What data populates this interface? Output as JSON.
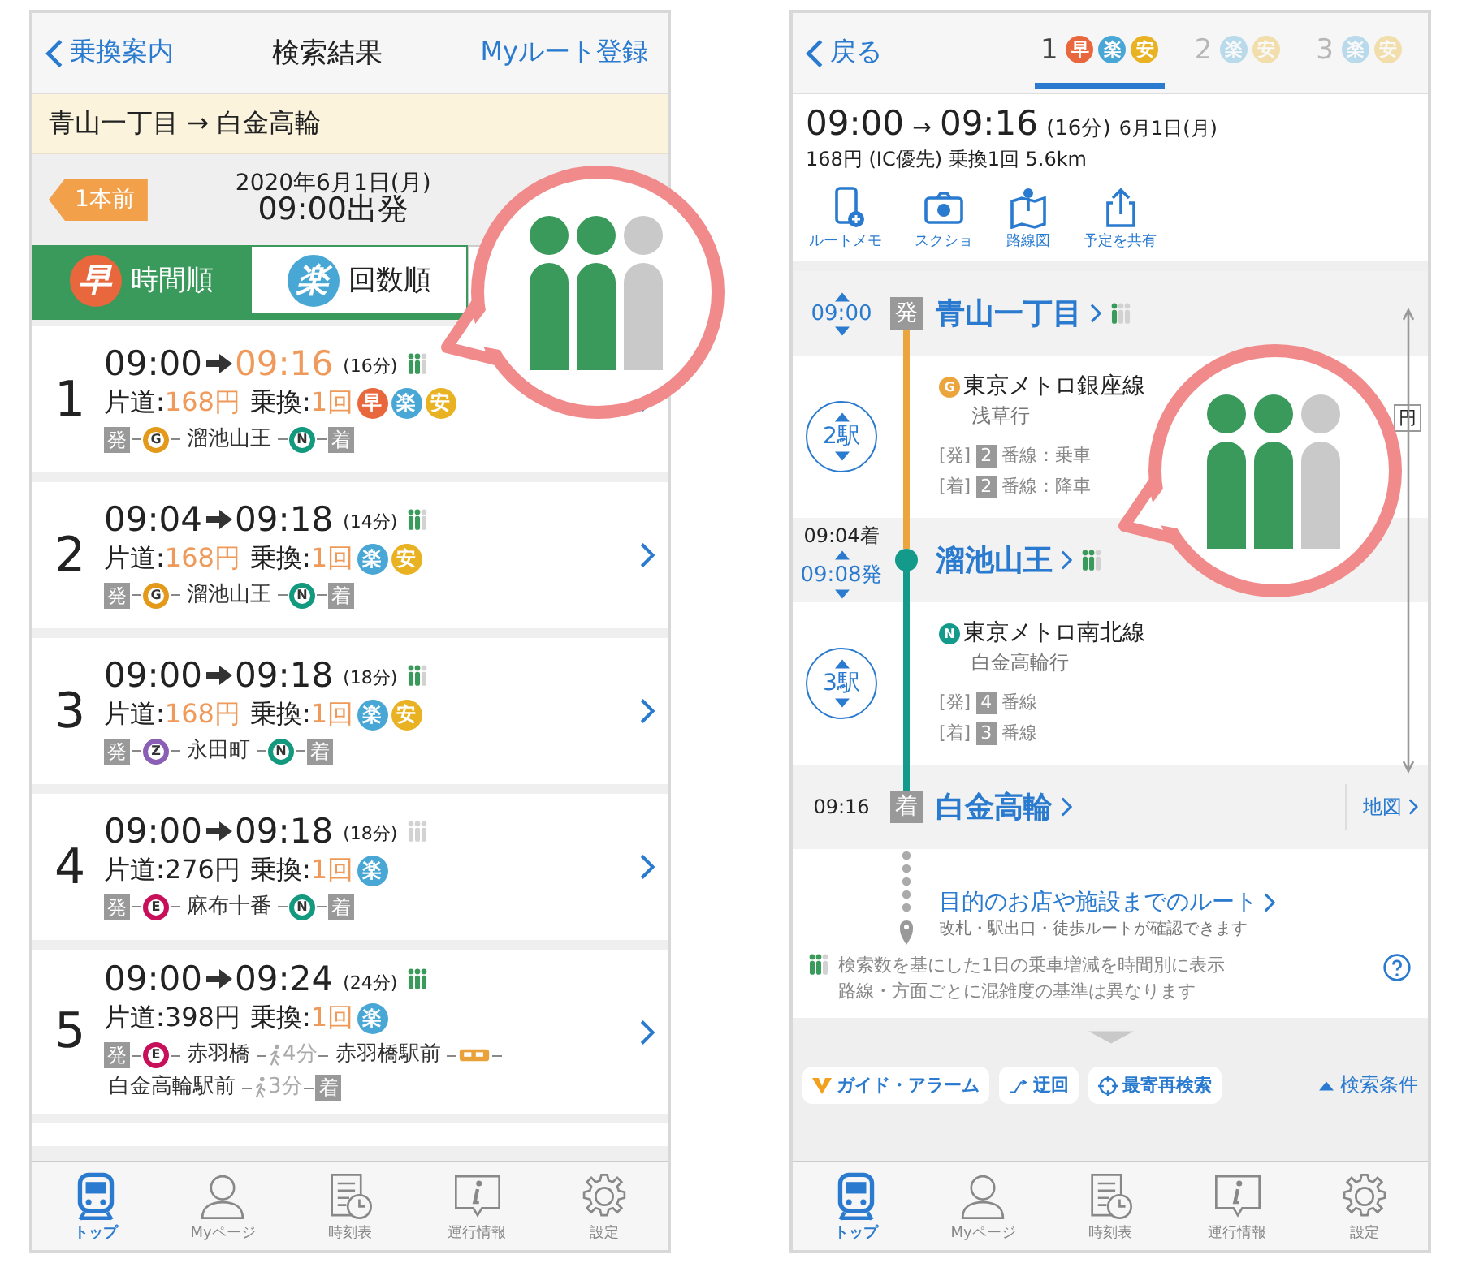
{
  "left": {
    "header": {
      "back": "乗換案内",
      "title": "検索結果",
      "action": "Myルート登録"
    },
    "route_bar": "青山一丁目 → 白金高輪",
    "prev_button": "1本前",
    "date": "2020年6月1日(月)",
    "departure": "09:00出発",
    "sort_tabs": [
      {
        "badge": "早",
        "kind": "fast",
        "label": "時間順",
        "selected": true
      },
      {
        "badge": "楽",
        "kind": "easy",
        "label": "回数順",
        "selected": false
      }
    ],
    "callout": {
      "crowd": [
        {
          "filled": true
        },
        {
          "filled": true
        },
        {
          "filled": false
        }
      ]
    },
    "routes": [
      {
        "number": "1",
        "depart": "09:00",
        "arrive": "09:16",
        "arrive_highlight": true,
        "duration": "(16分)",
        "crowd": [
          {
            "filled": true
          },
          {
            "filled": true
          },
          {
            "filled": false
          }
        ],
        "fare_label": "片道:",
        "fare": "168円",
        "fare_highlight": true,
        "transfer_label": "乗換:",
        "transfers": "1回",
        "transfers_highlight": true,
        "tags": [
          {
            "label": "早",
            "kind": "fast"
          },
          {
            "label": "楽",
            "kind": "easy"
          },
          {
            "label": "安",
            "kind": "safe"
          }
        ],
        "segments": [
          {
            "kind": "dep",
            "label": "発"
          },
          {
            "kind": "line",
            "label": "G",
            "color": "#e39a1b"
          },
          {
            "kind": "station",
            "label": "溜池山王"
          },
          {
            "kind": "line",
            "label": "N",
            "color": "#139a7e"
          },
          {
            "kind": "arr",
            "label": "着"
          }
        ]
      },
      {
        "number": "2",
        "depart": "09:04",
        "arrive": "09:18",
        "arrive_highlight": false,
        "duration": "(14分)",
        "crowd": [
          {
            "filled": true
          },
          {
            "filled": true
          },
          {
            "filled": false
          }
        ],
        "fare_label": "片道:",
        "fare": "168円",
        "fare_highlight": true,
        "transfer_label": "乗換:",
        "transfers": "1回",
        "transfers_highlight": true,
        "tags": [
          {
            "label": "楽",
            "kind": "easy"
          },
          {
            "label": "安",
            "kind": "safe"
          }
        ],
        "segments": [
          {
            "kind": "dep",
            "label": "発"
          },
          {
            "kind": "line",
            "label": "G",
            "color": "#e39a1b"
          },
          {
            "kind": "station",
            "label": "溜池山王"
          },
          {
            "kind": "line",
            "label": "N",
            "color": "#139a7e"
          },
          {
            "kind": "arr",
            "label": "着"
          }
        ]
      },
      {
        "number": "3",
        "depart": "09:00",
        "arrive": "09:18",
        "arrive_highlight": false,
        "duration": "(18分)",
        "crowd": [
          {
            "filled": true
          },
          {
            "filled": true
          },
          {
            "filled": false
          }
        ],
        "fare_label": "片道:",
        "fare": "168円",
        "fare_highlight": true,
        "transfer_label": "乗換:",
        "transfers": "1回",
        "transfers_highlight": true,
        "tags": [
          {
            "label": "楽",
            "kind": "easy"
          },
          {
            "label": "安",
            "kind": "safe"
          }
        ],
        "segments": [
          {
            "kind": "dep",
            "label": "発"
          },
          {
            "kind": "line",
            "label": "Z",
            "color": "#8b5fb5"
          },
          {
            "kind": "station",
            "label": "永田町"
          },
          {
            "kind": "line",
            "label": "N",
            "color": "#139a7e"
          },
          {
            "kind": "arr",
            "label": "着"
          }
        ]
      },
      {
        "number": "4",
        "depart": "09:00",
        "arrive": "09:18",
        "arrive_highlight": false,
        "duration": "(18分)",
        "crowd": [
          {
            "filled": false
          },
          {
            "filled": false
          },
          {
            "filled": false
          }
        ],
        "fare_label": "片道:",
        "fare": "276円",
        "fare_highlight": false,
        "transfer_label": "乗換:",
        "transfers": "1回",
        "transfers_highlight": true,
        "tags": [
          {
            "label": "楽",
            "kind": "easy"
          }
        ],
        "segments": [
          {
            "kind": "dep",
            "label": "発"
          },
          {
            "kind": "line",
            "label": "E",
            "color": "#c8105a"
          },
          {
            "kind": "station",
            "label": "麻布十番"
          },
          {
            "kind": "line",
            "label": "N",
            "color": "#139a7e"
          },
          {
            "kind": "arr",
            "label": "着"
          }
        ]
      },
      {
        "number": "5",
        "depart": "09:00",
        "arrive": "09:24",
        "arrive_highlight": false,
        "duration": "(24分)",
        "crowd": [
          {
            "filled": true
          },
          {
            "filled": true
          },
          {
            "filled": true
          }
        ],
        "fare_label": "片道:",
        "fare": "398円",
        "fare_highlight": false,
        "transfer_label": "乗換:",
        "transfers": "1回",
        "transfers_highlight": true,
        "tags": [
          {
            "label": "楽",
            "kind": "easy"
          }
        ],
        "segments": [
          {
            "kind": "dep",
            "label": "発"
          },
          {
            "kind": "line",
            "label": "E",
            "color": "#c8105a"
          },
          {
            "kind": "station",
            "label": "赤羽橋"
          },
          {
            "kind": "walk",
            "label": "4分"
          },
          {
            "kind": "station",
            "label": "赤羽橋駅前"
          },
          {
            "kind": "bus"
          },
          {
            "kind": "station",
            "label": "白金高輪駅前"
          },
          {
            "kind": "walk",
            "label": "3分"
          },
          {
            "kind": "arr",
            "label": "着"
          }
        ]
      }
    ],
    "tab_bar": [
      {
        "kind": "train",
        "label": "トップ",
        "selected": true
      },
      {
        "kind": "person",
        "label": "Myページ",
        "selected": false
      },
      {
        "kind": "timetable",
        "label": "時刻表",
        "selected": false
      },
      {
        "kind": "info",
        "label": "運行情報",
        "selected": false
      },
      {
        "kind": "gear",
        "label": "設定",
        "selected": false
      }
    ]
  },
  "right": {
    "header": {
      "back": "戻る",
      "route_tabs": [
        {
          "number": "1",
          "selected": true,
          "tags": [
            {
              "label": "早",
              "kind": "fast"
            },
            {
              "label": "楽",
              "kind": "easy"
            },
            {
              "label": "安",
              "kind": "safe"
            }
          ]
        },
        {
          "number": "2",
          "selected": false,
          "tags": [
            {
              "label": "楽",
              "kind": "easy"
            },
            {
              "label": "安",
              "kind": "safe"
            }
          ]
        },
        {
          "number": "3",
          "selected": false,
          "tags": [
            {
              "label": "楽",
              "kind": "easy"
            },
            {
              "label": "安",
              "kind": "safe"
            }
          ]
        }
      ]
    },
    "summary": {
      "depart": "09:00",
      "arrow": "→",
      "arrive": "09:16",
      "duration": "(16分)",
      "date": "6月1日(月)",
      "details": "168円 (IC優先) 乗換1回 5.6km"
    },
    "actions": [
      {
        "kind": "memo",
        "label": "ルートメモ"
      },
      {
        "kind": "camera",
        "label": "スクショ"
      },
      {
        "kind": "map",
        "label": "路線図"
      },
      {
        "kind": "share",
        "label": "予定を共有"
      }
    ],
    "callout": {
      "crowd": [
        {
          "filled": true
        },
        {
          "filled": true
        },
        {
          "filled": false
        }
      ]
    },
    "timeline": [
      {
        "kind": "station",
        "depart_time": "09:00",
        "badge": "発",
        "name": "青山一丁目",
        "crowd": [
          {
            "filled": true
          },
          {
            "filled": false
          },
          {
            "filled": false
          }
        ]
      },
      {
        "kind": "segment",
        "stops": "2駅",
        "color": "#eba53c",
        "line_badge": "G",
        "line": "東京メトロ銀座線",
        "direction": "浅草行",
        "fare": "円",
        "platforms": [
          {
            "tag": "[発]",
            "number": "2",
            "text": "番線：乗車"
          },
          {
            "tag": "[着]",
            "number": "2",
            "text": "番線：降車"
          }
        ]
      },
      {
        "kind": "station",
        "arrive_time": "09:04着",
        "depart_time": "09:08発",
        "name": "溜池山王",
        "crowd": [
          {
            "filled": true
          },
          {
            "filled": true
          },
          {
            "filled": false
          }
        ]
      },
      {
        "kind": "segment",
        "stops": "3駅",
        "color": "#139a8a",
        "line_badge": "N",
        "line": "東京メトロ南北線",
        "direction": "白金高輪行",
        "platforms": [
          {
            "tag": "[発]",
            "number": "4",
            "text": "番線"
          },
          {
            "tag": "[着]",
            "number": "3",
            "text": "番線"
          }
        ]
      },
      {
        "kind": "station",
        "arrive_time": "09:16",
        "badge": "着",
        "name": "白金高輪",
        "map": "地図"
      },
      {
        "kind": "destination",
        "title": "目的のお店や施設までのルート",
        "subtitle": "改札・駅出口・徒歩ルートが確認できます"
      }
    ],
    "note": {
      "crowd": [
        {
          "filled": true
        },
        {
          "filled": true
        },
        {
          "filled": false
        }
      ],
      "lines": [
        "検索数を基にした1日の乗車増減を時間別に表示",
        "路線・方面ごとに混雑度の基準は異なります"
      ]
    },
    "tools": [
      {
        "kind": "alarm",
        "label": "ガイド・アラーム"
      },
      {
        "kind": "detour",
        "label": "迂回"
      },
      {
        "kind": "nearest",
        "label": "最寄再検索"
      }
    ],
    "conditions": "検索条件",
    "tab_bar": [
      {
        "kind": "train",
        "label": "トップ",
        "selected": true
      },
      {
        "kind": "person",
        "label": "Myページ",
        "selected": false
      },
      {
        "kind": "timetable",
        "label": "時刻表",
        "selected": false
      },
      {
        "kind": "info",
        "label": "運行情報",
        "selected": false
      },
      {
        "kind": "gear",
        "label": "設定",
        "selected": false
      }
    ]
  }
}
